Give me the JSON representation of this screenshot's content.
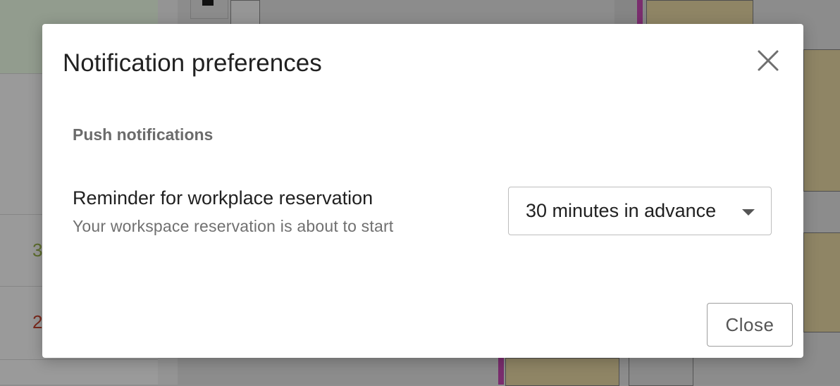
{
  "background": {
    "sidebar_numbers": [
      "3",
      "2"
    ]
  },
  "modal": {
    "title": "Notification preferences",
    "close_icon": "close-icon",
    "section_heading": "Push notifications",
    "setting": {
      "title": "Reminder for workplace reservation",
      "description": "Your workspace reservation is about to start",
      "selected_value": "30 minutes in advance",
      "caret_icon": "caret-down-icon"
    },
    "close_button_label": "Close"
  },
  "colors": {
    "overlay": "#8e8e8e",
    "modal_background": "#ffffff",
    "title_text": "#212121",
    "muted_text": "#707070"
  }
}
